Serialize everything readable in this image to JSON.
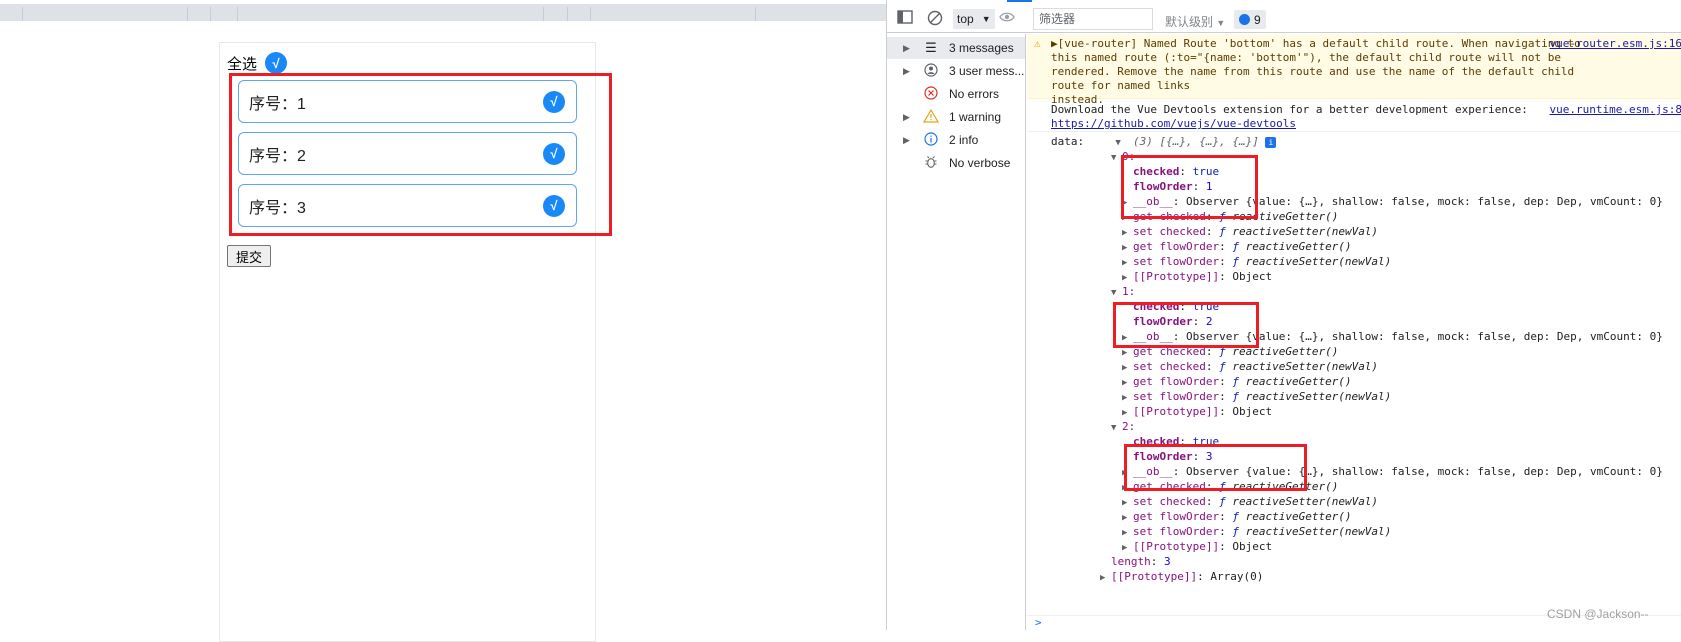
{
  "page": {
    "select_all_label": "全选",
    "check_mark": "√",
    "items": [
      {
        "label": "序号：1"
      },
      {
        "label": "序号：2"
      },
      {
        "label": "序号：3"
      }
    ],
    "submit_label": "提交"
  },
  "devtools": {
    "context": "top",
    "filter_placeholder": "筛选器",
    "level": "默认级别",
    "issues_count": "9",
    "sidebar": [
      {
        "label": "3 messages",
        "icon": "list-icon",
        "selected": true,
        "expandable": true
      },
      {
        "label": "3 user mess...",
        "icon": "user-icon",
        "selected": false,
        "expandable": true
      },
      {
        "label": "No errors",
        "icon": "error-icon",
        "selected": false,
        "expandable": false
      },
      {
        "label": "1 warning",
        "icon": "warning-icon",
        "selected": false,
        "expandable": true
      },
      {
        "label": "2 info",
        "icon": "info-icon",
        "selected": false,
        "expandable": true
      },
      {
        "label": "No verbose",
        "icon": "bug-icon",
        "selected": false,
        "expandable": false
      }
    ],
    "warning": {
      "text": "▶[vue-router] Named Route 'bottom' has a default child route. When navigating to\nthis named route (:to=\"{name: 'bottom'\"), the default child route will not be\nrendered. Remove the name from this route and use the name of the default child route for named links\ninstead.",
      "source": "vue-router.esm.js:16"
    },
    "devtools_hint": {
      "text": "Download the Vue Devtools extension for a better development experience:",
      "link": "https://github.com/vuejs/vue-devtools",
      "source": "vue.runtime.esm.js:8"
    },
    "data_label": "data:",
    "array_summary": "(3) [{…}, {…}, {…}]",
    "objects": [
      {
        "index": "0:",
        "checked": "true",
        "flowOrder": "1",
        "ob": "Observer {value: {…}, shallow: false, mock: false, dep: Dep, vmCount: 0}"
      },
      {
        "index": "1:",
        "checked": "true",
        "flowOrder": "2",
        "ob": "Observer {value: {…}, shallow: false, mock: false, dep: Dep, vmCount: 0}"
      },
      {
        "index": "2:",
        "checked": "true",
        "flowOrder": "3",
        "ob": "Observer {value: {…}, shallow: false, mock: false, dep: Dep, vmCount: 0}"
      }
    ],
    "getter_text": "reactiveGetter()",
    "setter_text": "reactiveSetter(newVal)",
    "prototype_text": "Object",
    "length_text": "3",
    "array_proto_text": "Array(0)"
  },
  "watermark": "CSDN @Jackson--"
}
